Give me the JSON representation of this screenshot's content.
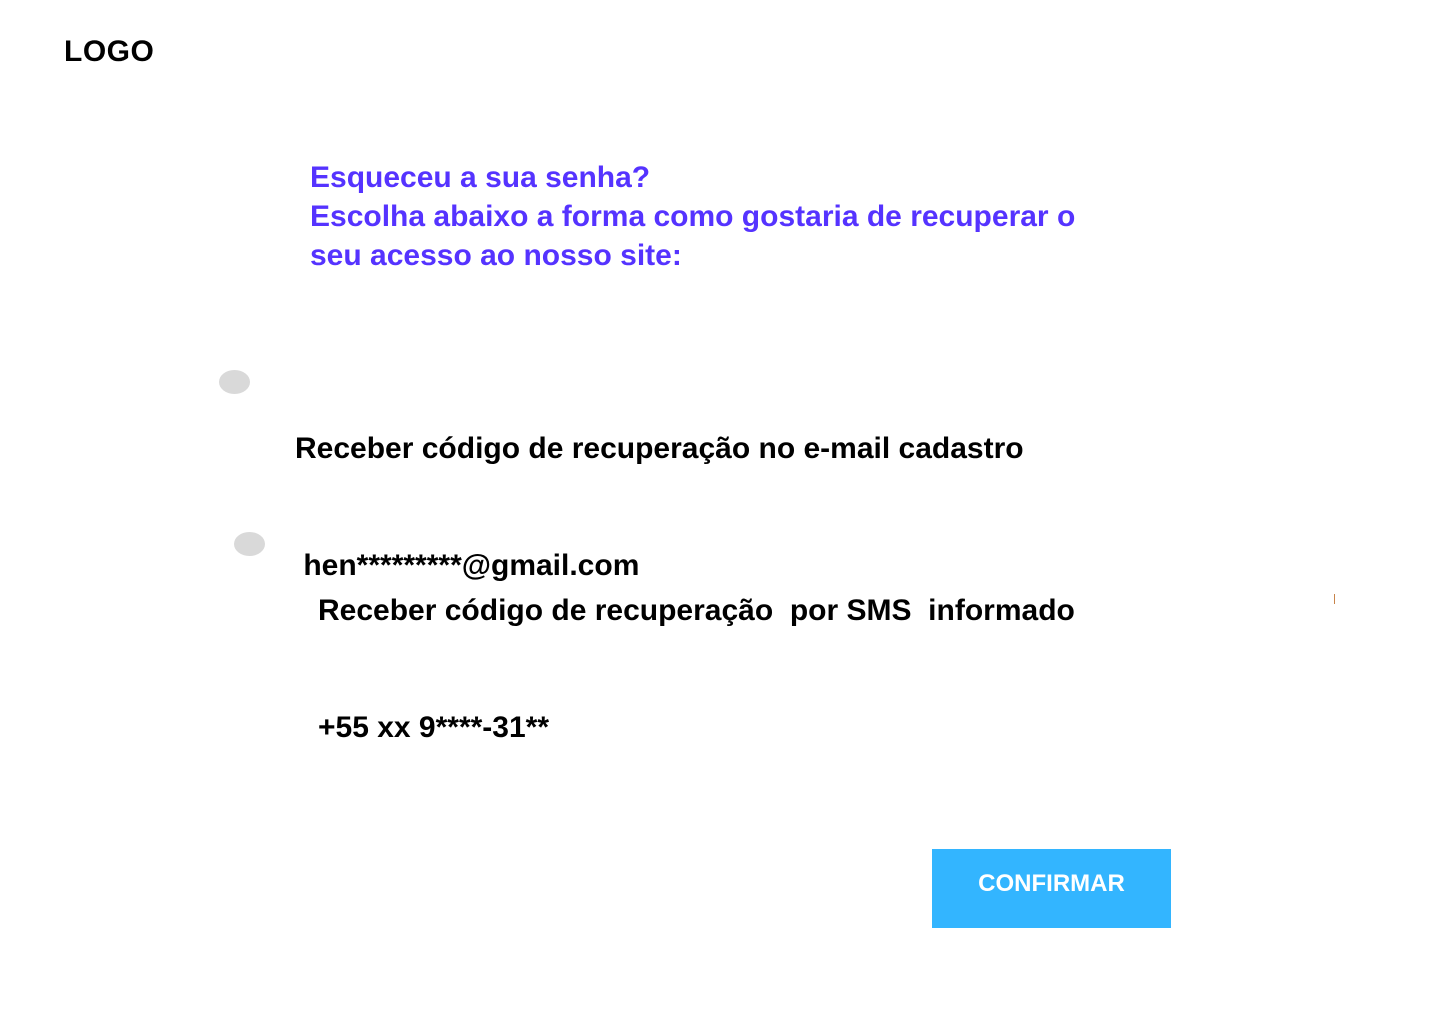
{
  "header": {
    "logo": "LOGO"
  },
  "heading": {
    "line1": "Esqueceu a sua senha?",
    "line2": "Escolha abaixo a forma como gostaria de recuperar o",
    "line3": "seu acesso ao nosso site:",
    "color": "#5533ff"
  },
  "options": [
    {
      "line1": "Receber código de recuperação no e-mail cadastro",
      "line2": " hen*********@gmail.com",
      "selected": false
    },
    {
      "line1": "Receber código de recuperação  por SMS  informado",
      "line2": "+55 xx 9****-31**",
      "selected": false
    }
  ],
  "confirm_button": {
    "label": "CONFIRMAR",
    "color": "#33b5ff"
  }
}
